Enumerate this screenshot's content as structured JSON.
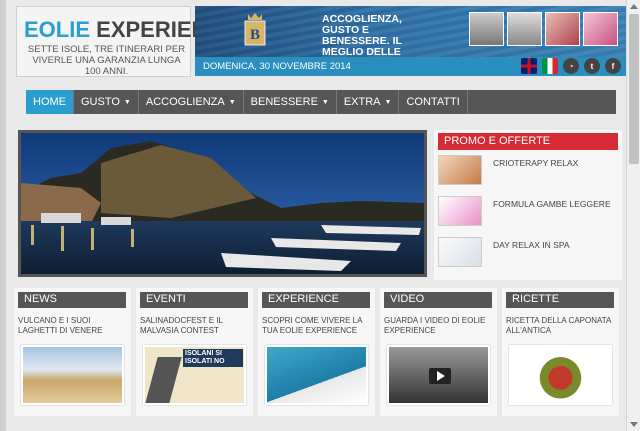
{
  "header": {
    "logo_title_1": "EOLIE",
    "logo_title_2": "EXPERIENCE",
    "logo_subtitle": "SETTE ISOLE, TRE ITINERARI PER VIVERLE UNA GARANZIA LUNGA 100 ANNI.",
    "banner_text": "ACCOGLIENZA, GUSTO E BENESSERE. IL MEGLIO DELLE EOLIE.",
    "hotel_mark": "B",
    "date": "DOMENICA, 30 NOVEMBRE 2014"
  },
  "social": {
    "icons": [
      "flag-uk-icon",
      "flag-it-icon",
      "rss-icon",
      "twitter-icon",
      "facebook-icon"
    ],
    "rss": "◔",
    "twitter": "t",
    "facebook": "f"
  },
  "nav": {
    "items": [
      {
        "label": "HOME",
        "active": true,
        "dropdown": false
      },
      {
        "label": "GUSTO",
        "dropdown": true
      },
      {
        "label": "ACCOGLIENZA",
        "dropdown": true
      },
      {
        "label": "BENESSERE",
        "dropdown": true
      },
      {
        "label": "EXTRA",
        "dropdown": true
      },
      {
        "label": "CONTATTI",
        "dropdown": false
      }
    ],
    "chevron": "▼"
  },
  "promo": {
    "title": "PROMO E OFFERTE",
    "items": [
      {
        "label": "CRIOTERAPY RELAX"
      },
      {
        "label": "FORMULA GAMBE LEGGERE"
      },
      {
        "label": "DAY RELAX IN SPA"
      }
    ]
  },
  "cards": [
    {
      "title": "NEWS",
      "text": "VULCANO E I SUOI LAGHETTI DI VENERE"
    },
    {
      "title": "EVENTI",
      "text": "SALINADOCFEST E IL MALVASIA CONTEST",
      "img_text": "ISOLANI SI ISOLATI NO"
    },
    {
      "title": "EXPERIENCE",
      "text": "SCOPRI COME VIVERE LA TUA EOLIE EXPERIENCE"
    },
    {
      "title": "VIDEO",
      "text": "GUARDA I VIDEO DI EOLIE EXPERIENCE"
    },
    {
      "title": "RICETTE",
      "text": "RICETTA DELLA CAPONATA ALL'ANTICA"
    }
  ],
  "colors": {
    "accent": "#2a9fcf",
    "nav_bg": "#565656",
    "promo_red": "#d62b37"
  }
}
